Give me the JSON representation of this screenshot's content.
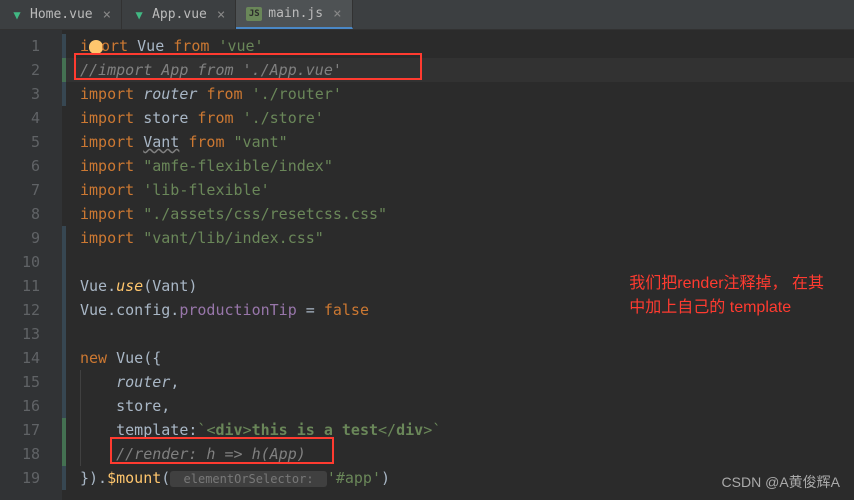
{
  "tabs": [
    {
      "icon": "vue",
      "label": "Home.vue",
      "active": false
    },
    {
      "icon": "vue",
      "label": "App.vue",
      "active": false
    },
    {
      "icon": "js",
      "label": "main.js",
      "active": true
    }
  ],
  "lines": {
    "l1_kw": "import",
    "l1_id": "Vue",
    "l1_from": "from",
    "l1_str": "'vue'",
    "l2_comment": "//import App from './App.vue'",
    "l3_kw": "import",
    "l3_id": "router",
    "l3_from": "from",
    "l3_str": "'./router'",
    "l4_kw": "import",
    "l4_id": "store",
    "l4_from": "from",
    "l4_str": "'./store'",
    "l5_kw": "import",
    "l5_id": "Vant",
    "l5_from": "from",
    "l5_str": "\"vant\"",
    "l6_kw": "import",
    "l6_str": "\"amfe-flexible/index\"",
    "l7_kw": "import",
    "l7_str": "'lib-flexible'",
    "l8_kw": "import",
    "l8_str": "\"./assets/css/resetcss.css\"",
    "l9_kw": "import",
    "l9_str": "\"vant/lib/index.css\"",
    "l11_obj": "Vue",
    "l11_dot": ".",
    "l11_fn": "use",
    "l11_arg": "(Vant)",
    "l12_obj": "Vue",
    "l12_p1": ".config.",
    "l12_p2": "productionTip",
    "l12_eq": " = ",
    "l12_val": "false",
    "l14_kw": "new",
    "l14_cls": "Vue",
    "l14_open": "({",
    "l15_prop": "router",
    "l15_comma": ",",
    "l16_prop": "store",
    "l16_comma": ",",
    "l17_prop": "template",
    "l17_colon": ":",
    "l17_bt1": "`",
    "l17_t1": "<",
    "l17_tag1": "div",
    "l17_t2": ">",
    "l17_text": "this is a test",
    "l17_t3": "</",
    "l17_tag2": "div",
    "l17_t4": ">",
    "l17_bt2": "`",
    "l18_comment": "//render: h => h(App)",
    "l19_close": "}).",
    "l19_fn": "$mount",
    "l19_p1": "(",
    "l19_hint": " elementOrSelector: ",
    "l19_str": "'#app'",
    "l19_p2": ")"
  },
  "line_numbers": [
    "1",
    "2",
    "3",
    "4",
    "5",
    "6",
    "7",
    "8",
    "9",
    "10",
    "11",
    "12",
    "13",
    "14",
    "15",
    "16",
    "17",
    "18",
    "19"
  ],
  "annotation_l1": "我们把render注释掉，   在其",
  "annotation_l2": "中加上自己的 template",
  "watermark": "CSDN @A黄俊辉A"
}
